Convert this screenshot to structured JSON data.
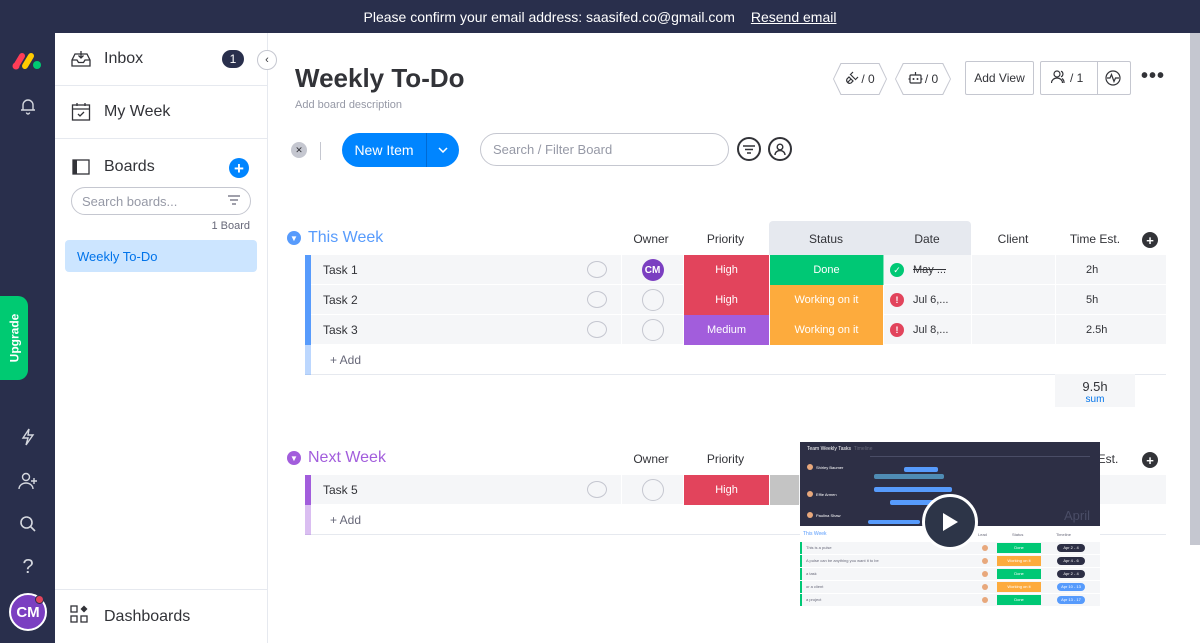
{
  "banner": {
    "message": "Please confirm your email address: saasifed.co@gmail.com",
    "resend": "Resend email"
  },
  "rail": {
    "upgrade": "Upgrade",
    "avatar_initials": "CM"
  },
  "panel": {
    "inbox": "Inbox",
    "inbox_count": "1",
    "my_week": "My Week",
    "boards": "Boards",
    "search_placeholder": "Search boards...",
    "board_count": "1 Board",
    "selected_board": "Weekly To-Do",
    "dashboards": "Dashboards"
  },
  "main": {
    "title": "Weekly To-Do",
    "description": "Add board description",
    "integrations_count": "/ 0",
    "automations_count": "/ 0",
    "add_view": "Add View",
    "members_count": "/ 1",
    "new_item": "New Item",
    "filter_placeholder": "Search / Filter Board"
  },
  "columns": {
    "owner": "Owner",
    "priority": "Priority",
    "status": "Status",
    "date": "Date",
    "client": "Client",
    "time": "Time Est.",
    "time_short": "Est."
  },
  "groups": [
    {
      "title": "This Week",
      "color": "#579bfc",
      "rows": [
        {
          "name": "Task 1",
          "owner": "CM",
          "priority": "High",
          "priority_color": "#e2445c",
          "status": "Done",
          "status_color": "#00c875",
          "date": "May ...",
          "date_state": "done",
          "time": "2h"
        },
        {
          "name": "Task 2",
          "owner": "",
          "priority": "High",
          "priority_color": "#e2445c",
          "status": "Working on it",
          "status_color": "#fdab3d",
          "date": "Jul 6,...",
          "date_state": "late",
          "time": "5h"
        },
        {
          "name": "Task 3",
          "owner": "",
          "priority": "Medium",
          "priority_color": "#a25ddc",
          "status": "Working on it",
          "status_color": "#fdab3d",
          "date": "Jul 8,...",
          "date_state": "late",
          "time": "2.5h"
        }
      ],
      "add": "+ Add",
      "sum_value": "9.5h",
      "sum_label": "sum"
    },
    {
      "title": "Next Week",
      "color": "#a25ddc",
      "rows": [
        {
          "name": "Task 5",
          "owner": "",
          "priority": "High",
          "priority_color": "#e2445c"
        }
      ],
      "add": "+ Add"
    }
  ],
  "video": {
    "header_title": "Team Weekly Tasks",
    "header_tab": "Timeline",
    "rows_people": [
      "Shirley Baumer",
      "Effie Armen",
      "Paulina Shaw"
    ],
    "month": "April",
    "table_group": "This Week",
    "table_cols": [
      "Lead",
      "Status",
      "Timeline"
    ],
    "table_rows": [
      {
        "name": "This is a pulse",
        "status": "Done",
        "timeline": "Apr 2 - 4"
      },
      {
        "name": "A pulse can be anything you want it to be",
        "status": "Working on it",
        "timeline": "Apr 4 - 6"
      },
      {
        "name": "a task",
        "status": "Done",
        "timeline": "Apr 2 - 4"
      },
      {
        "name": "or a client",
        "status": "Working on it",
        "timeline": "Apr 10 - 13"
      },
      {
        "name": "a project",
        "status": "Done",
        "timeline": "Apr 13 - 17"
      }
    ]
  },
  "colors": {
    "accent": "#0085ff",
    "nav_bg": "#292f4c",
    "upgrade": "#00ca72"
  }
}
